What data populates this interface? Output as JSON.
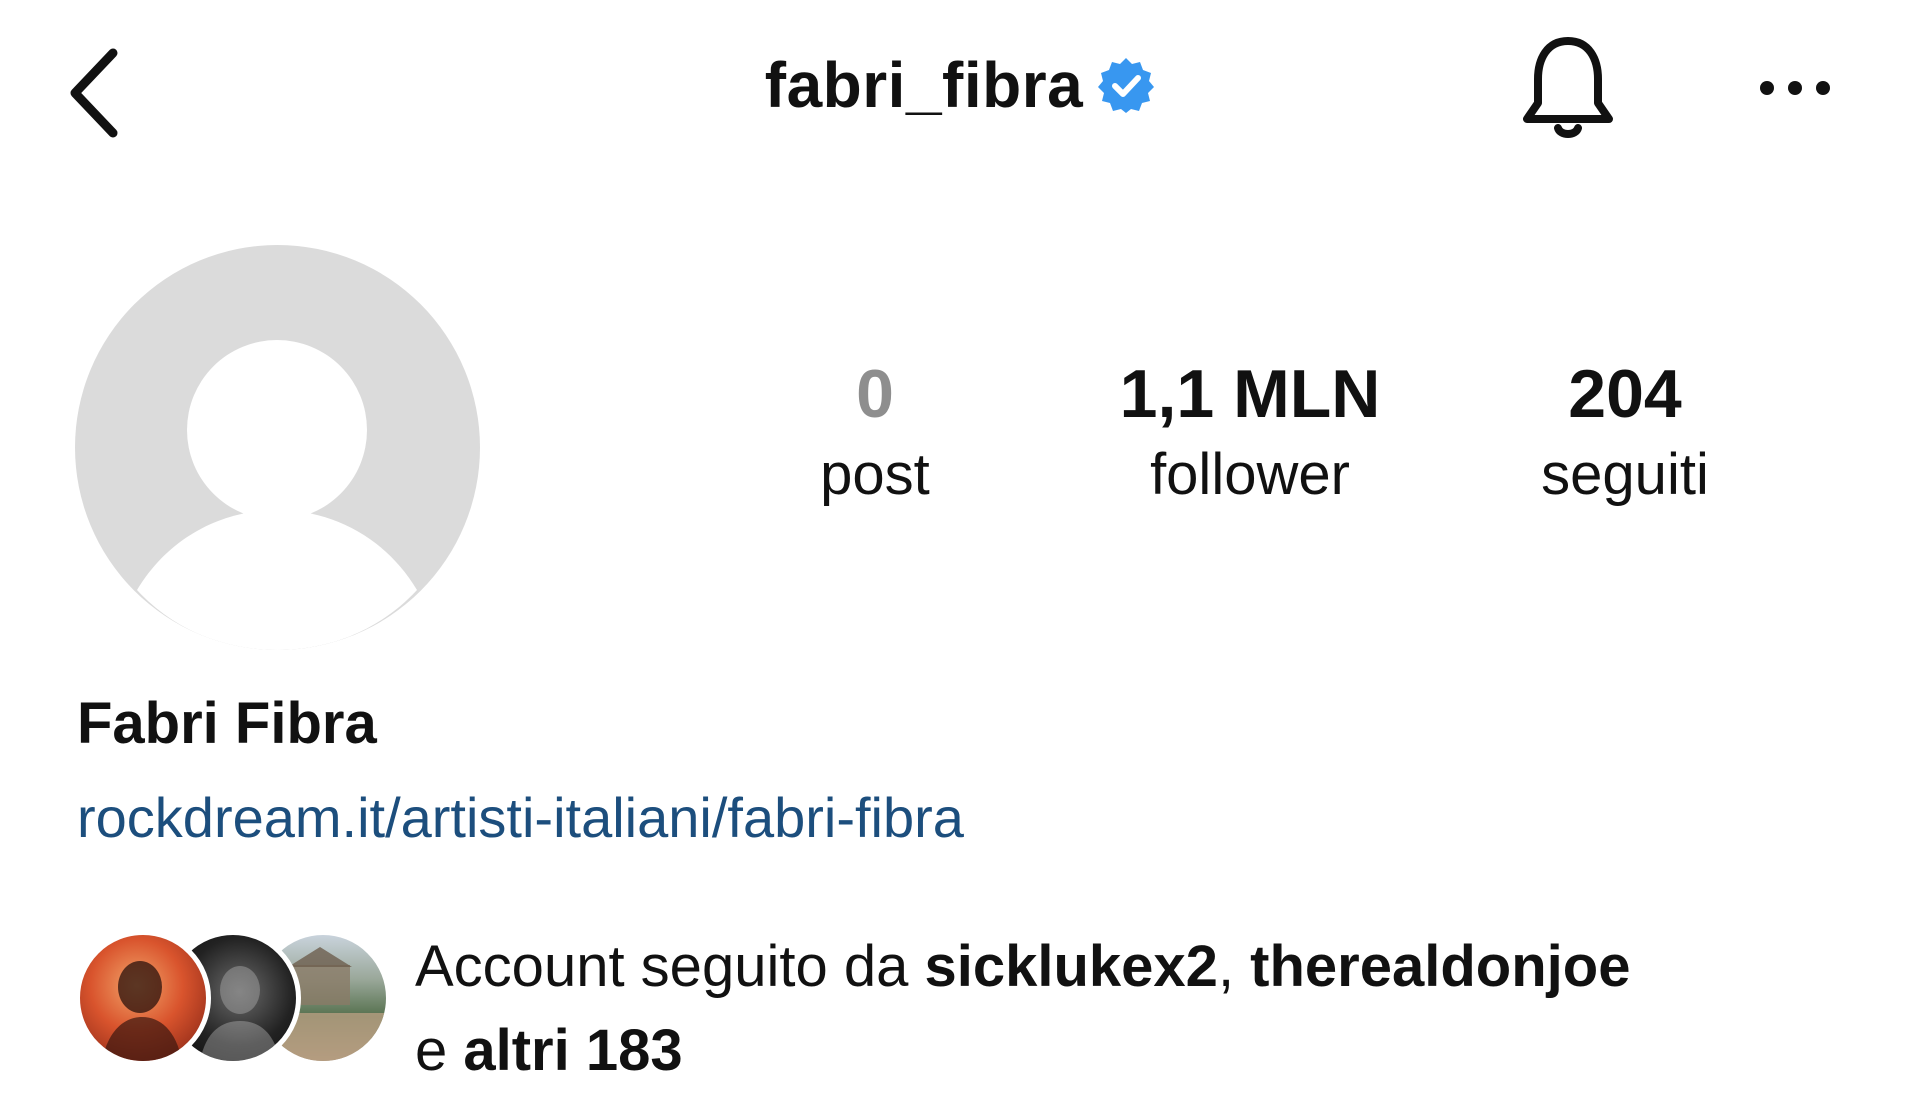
{
  "header": {
    "username": "fabri_fibra",
    "verified": true,
    "icons": {
      "back": "chevron-left-icon",
      "verified": "verified-badge-icon",
      "notifications": "bell-icon",
      "more": "more-horizontal-icon"
    }
  },
  "profile": {
    "avatar": "default-avatar-placeholder",
    "full_name": "Fabri Fibra",
    "link": "rockdream.it/artisti-italiani/fabri-fibra"
  },
  "stats": {
    "posts": {
      "count": "0",
      "label": "post"
    },
    "followers": {
      "count": "1,1 MLN",
      "label": "follower"
    },
    "following": {
      "count": "204",
      "label": "seguiti"
    }
  },
  "mutual": {
    "prefix": "Account seguito da ",
    "user1": "sicklukex2",
    "separator": ", ",
    "user2": "therealdonjoe",
    "connector": "e ",
    "others": "altri 183"
  },
  "colors": {
    "verified_blue": "#3897f0",
    "link_blue": "#1c4e7d",
    "avatar_gray": "#dbdbdb",
    "muted_text": "#8e8e8e"
  }
}
